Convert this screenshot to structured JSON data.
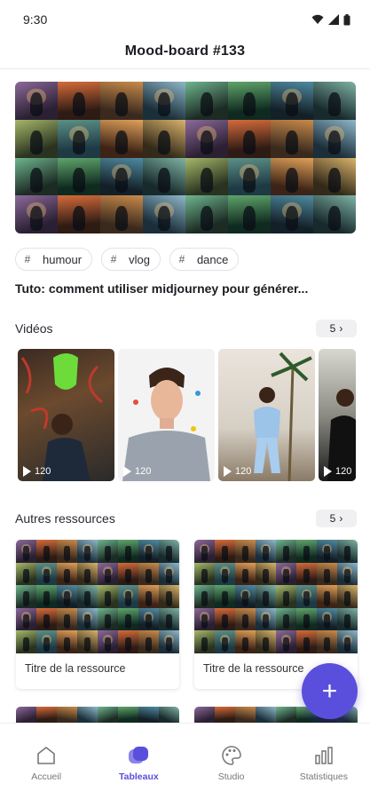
{
  "status": {
    "time": "9:30"
  },
  "header": {
    "title": "Mood-board #133"
  },
  "tags": [
    {
      "label": "humour"
    },
    {
      "label": "vlog"
    },
    {
      "label": "dance"
    }
  ],
  "description": "Tuto: comment utiliser midjourney pour générer...",
  "videos_section": {
    "title": "Vidéos",
    "count": "5",
    "items": [
      {
        "views": "120"
      },
      {
        "views": "120"
      },
      {
        "views": "120"
      },
      {
        "views": "120"
      }
    ]
  },
  "resources_section": {
    "title": "Autres ressources",
    "count": "5",
    "items": [
      {
        "title": "Titre de la ressource"
      },
      {
        "title": "Titre de la ressource"
      }
    ]
  },
  "fab": {
    "label": "+"
  },
  "nav": [
    {
      "label": "Accueil",
      "icon": "home-icon",
      "active": false
    },
    {
      "label": "Tableaux",
      "icon": "boards-icon",
      "active": true
    },
    {
      "label": "Studio",
      "icon": "palette-icon",
      "active": false
    },
    {
      "label": "Statistiques",
      "icon": "chart-icon",
      "active": false
    }
  ],
  "colors": {
    "accent": "#5a4fdc"
  }
}
